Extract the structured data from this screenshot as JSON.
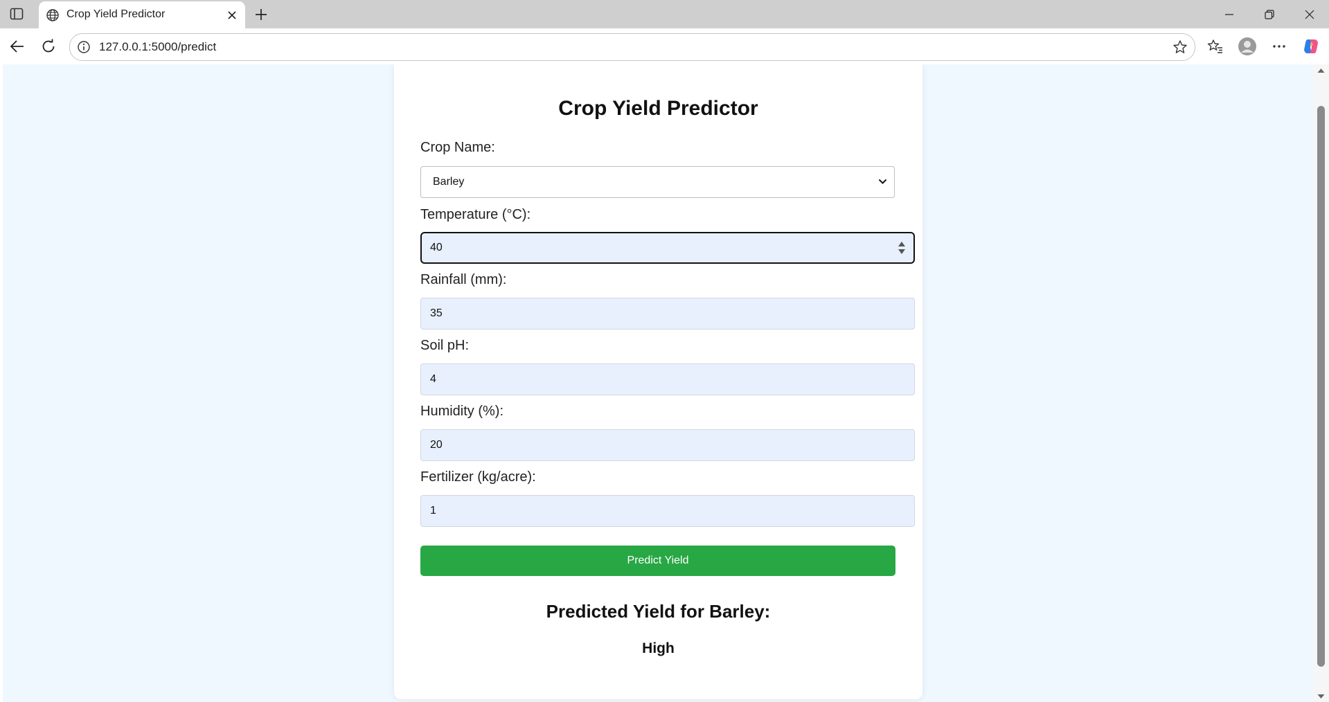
{
  "browser": {
    "tab_title": "Crop Yield Predictor",
    "url": "127.0.0.1:5000/predict"
  },
  "form": {
    "title": "Crop Yield Predictor",
    "crop": {
      "label": "Crop Name:",
      "value": "Barley"
    },
    "temperature": {
      "label": "Temperature (°C):",
      "value": "40"
    },
    "rainfall": {
      "label": "Rainfall (mm):",
      "value": "35"
    },
    "soil_ph": {
      "label": "Soil pH:",
      "value": "4"
    },
    "humidity": {
      "label": "Humidity (%):",
      "value": "20"
    },
    "fertilizer": {
      "label": "Fertilizer (kg/acre):",
      "value": "1"
    },
    "submit_label": "Predict Yield"
  },
  "result": {
    "title": "Predicted Yield for Barley:",
    "value": "High"
  },
  "colors": {
    "page_bg": "#f0f8ff",
    "input_bg": "#e8f0fe",
    "button": "#28a745"
  }
}
